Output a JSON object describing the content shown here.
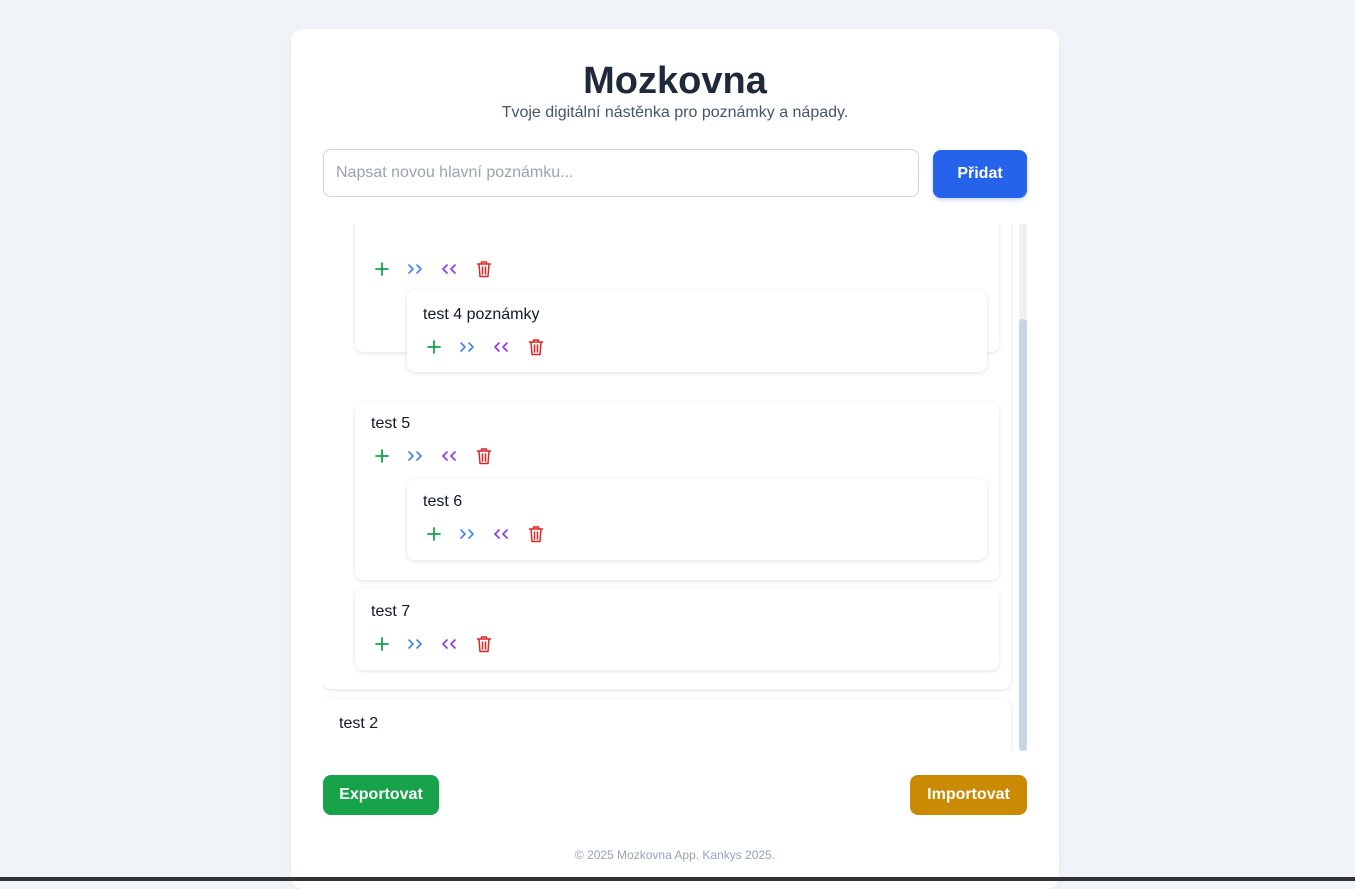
{
  "header": {
    "title": "Mozkovna",
    "subtitle": "Tvoje digitální nástěnka pro poznámky a nápady."
  },
  "new_note": {
    "placeholder": "Napsat novou hlavní poznámku...",
    "value": "",
    "add_label": "Přidat"
  },
  "icons": {
    "add": "plus-icon",
    "indent": "indent-icon",
    "outdent": "outdent-icon",
    "delete": "trash-icon"
  },
  "colors": {
    "add": "#16a34a",
    "indent": "#3b82f6",
    "outdent": "#9333ea",
    "delete": "#dc2626",
    "primary": "#2563eb",
    "export": "#16a34a",
    "import": "#ca8a04"
  },
  "notes": {
    "n4": "test 4 poznámky",
    "n5": "test 5",
    "n6": "test 6",
    "n7": "test 7",
    "n2": "test 2"
  },
  "actions": {
    "export_label": "Exportovat",
    "import_label": "Importovat"
  },
  "footer": "© 2025 Mozkovna App. Kankys 2025."
}
